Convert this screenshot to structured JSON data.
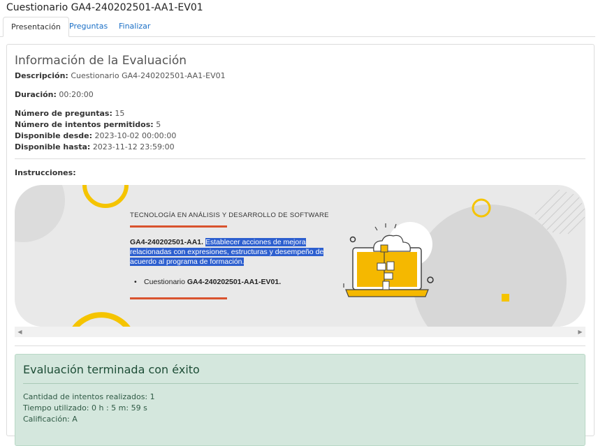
{
  "window": {
    "title": "Cuestionario GA4-240202501-AA1-EV01"
  },
  "tabs": [
    {
      "label": "Presentación"
    },
    {
      "label": "Preguntas"
    },
    {
      "label": "Finalizar"
    }
  ],
  "info": {
    "title": "Información de la Evaluación",
    "descripcion_label": "Descripción:",
    "descripcion_value": "Cuestionario GA4-240202501-AA1-EV01",
    "duracion_label": "Duración:",
    "duracion_value": "00:20:00",
    "num_preguntas_label": "Número de preguntas:",
    "num_preguntas_value": "15",
    "num_intentos_label": "Número de intentos permitidos:",
    "num_intentos_value": "5",
    "desde_label": "Disponible desde:",
    "desde_value": "2023-10-02 00:00:00",
    "hasta_label": "Disponible hasta:",
    "hasta_value": "2023-11-12 23:59:00",
    "instrucciones_label": "Instrucciones:"
  },
  "banner": {
    "subtitle": "TECNOLOGÍA EN ANÁLISIS Y DESARROLLO DE SOFTWARE",
    "code": "GA4-240202501-AA1.",
    "highlighted_text": "Establecer acciones de mejora relacionadas con expresiones, estructuras y desempeño de acuerdo al programa de formación.",
    "list_prefix": "Cuestionario",
    "list_code": "GA4-240202501-AA1-EV01.",
    "colors": {
      "accent_line": "#d9532e",
      "yellow": "#f5c400",
      "highlight": "#2d5fcf"
    }
  },
  "result": {
    "title": "Evaluación terminada con éxito",
    "intentos": "Cantidad de intentos realizados: 1",
    "tiempo": "Tiempo utilizado: 0 h : 5 m: 59 s",
    "calificacion": "Calificación: A"
  }
}
